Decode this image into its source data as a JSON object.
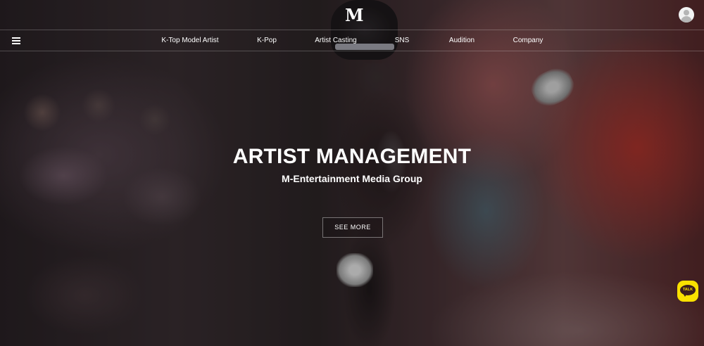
{
  "brand": {
    "logo_text": "M"
  },
  "nav": {
    "items": [
      {
        "label": "K-Top Model Artist"
      },
      {
        "label": "K-Pop"
      },
      {
        "label": "Artist Casting"
      },
      {
        "label": "SNS"
      },
      {
        "label": "Audition"
      },
      {
        "label": "Company"
      }
    ]
  },
  "hero": {
    "title": "ARTIST MANAGEMENT",
    "subtitle": "M-Entertainment Media Group",
    "button_label": "SEE MORE"
  },
  "chat": {
    "label": "TALK",
    "color": "#fae100"
  },
  "icons": {
    "menu": "hamburger-menu-icon",
    "user": "user-icon",
    "chat": "kakao-talk-icon"
  }
}
